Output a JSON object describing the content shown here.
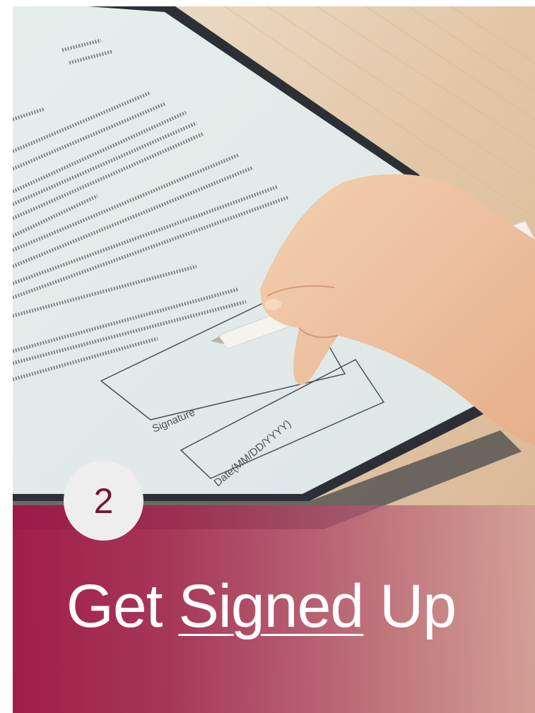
{
  "step": {
    "number": "2"
  },
  "title": {
    "before": "Get ",
    "emphasis": "Signed",
    "after": " Up"
  },
  "form": {
    "signature_label": "Signature",
    "date_label": "Date(MM/DD/YYYY)"
  },
  "colors": {
    "banner": "#9e1646",
    "badge_bg": "#eeeeee",
    "badge_text": "#7a1234",
    "title_text": "#ffffff"
  }
}
